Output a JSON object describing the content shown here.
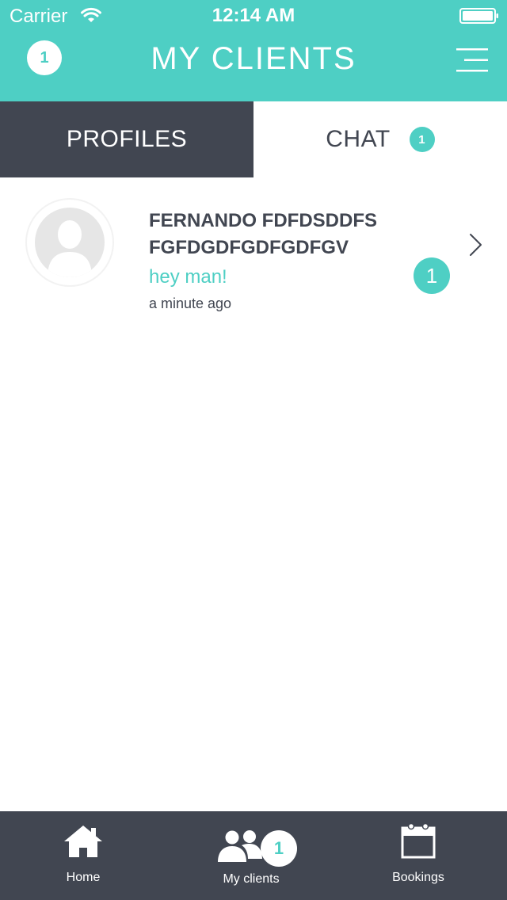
{
  "status_bar": {
    "carrier": "Carrier",
    "time": "12:14 AM",
    "wifi_icon": "wifi-icon",
    "battery_icon": "battery-full-icon"
  },
  "header": {
    "title": "MY CLIENTS",
    "notification_count": "1",
    "menu_icon": "hamburger-menu-icon"
  },
  "tabs": [
    {
      "label": "PROFILES",
      "active": true
    },
    {
      "label": "CHAT",
      "active": false,
      "badge": "1"
    }
  ],
  "chats": [
    {
      "name": "FERNANDO FDFDSDDFS FGFDGDFGDFGDFGV",
      "last_message": "hey man!",
      "time": "a minute ago",
      "unread": "1",
      "avatar_icon": "default-avatar-icon",
      "chevron_icon": "chevron-right-icon"
    }
  ],
  "bottom_nav": [
    {
      "label": "Home",
      "icon": "home-icon"
    },
    {
      "label": "My clients",
      "icon": "clients-icon",
      "badge": "1"
    },
    {
      "label": "Bookings",
      "icon": "calendar-icon"
    }
  ],
  "colors": {
    "accent": "#4ecfc4",
    "dark": "#414651",
    "white": "#ffffff"
  }
}
